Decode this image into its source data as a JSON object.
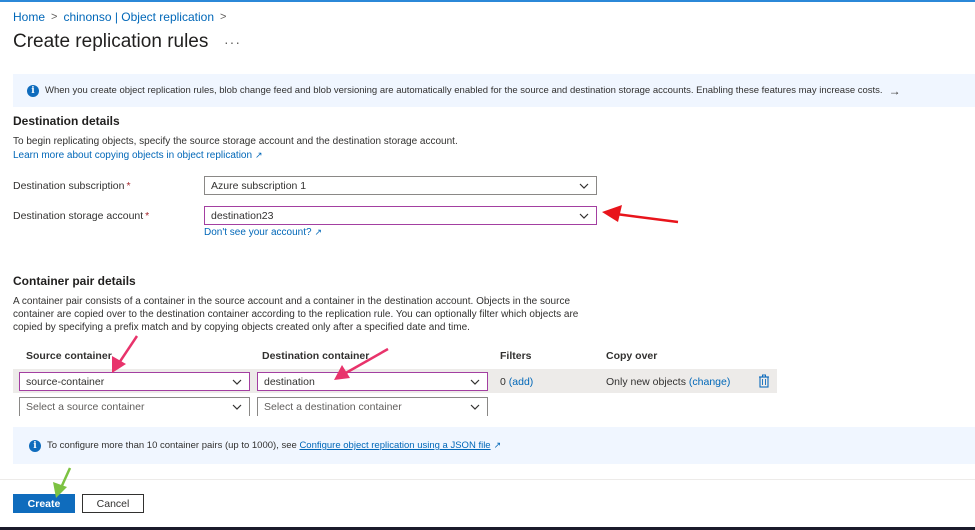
{
  "breadcrumb": {
    "home": "Home",
    "parent": "chinonso | Object replication"
  },
  "page": {
    "title": "Create replication rules",
    "more": "···"
  },
  "banner1": {
    "text": "When you create object replication rules, blob change feed and blob versioning are automatically enabled for the source and destination storage accounts. Enabling these features may increase costs.",
    "arrow": "→"
  },
  "destination": {
    "section_title": "Destination details",
    "description": "To begin replicating objects, specify the source storage account and the destination storage account.",
    "learn_more": "Learn more about copying objects in object replication",
    "subscription_label": "Destination subscription",
    "subscription_value": "Azure subscription 1",
    "account_label": "Destination storage account",
    "account_value": "destination23",
    "account_help": "Don't see your account?",
    "required_mark": "*"
  },
  "container_pairs": {
    "section_title": "Container pair details",
    "description_1": "A container pair consists of a container in the source account and a container in the destination account. Objects in the source",
    "description_2": "container are copied over to the destination container according to the replication rule. You can optionally filter which objects are",
    "description_3": "copied by specifying a prefix match and by copying objects created only after a specified date and time.",
    "headers": {
      "source": "Source container",
      "destination": "Destination container",
      "filters": "Filters",
      "copy_over": "Copy over"
    },
    "rows": [
      {
        "source": "source-container",
        "destination": "destination",
        "filters_count": "0",
        "filters_link": "(add)",
        "copy_over": "Only new objects",
        "copy_over_link": "(change)"
      }
    ],
    "new_row": {
      "source_placeholder": "Select a source container",
      "destination_placeholder": "Select a destination container"
    }
  },
  "banner2": {
    "text": "To configure more than 10 container pairs (up to 1000), see",
    "link": "Configure object replication using a JSON file"
  },
  "footer": {
    "create": "Create",
    "cancel": "Cancel"
  },
  "colors": {
    "accent": "#0f6cbd",
    "link": "#0067b8",
    "banner_bg": "#f0f6ff",
    "annotation_red": "#e8141b",
    "annotation_pink": "#e8336b",
    "annotation_green": "#7cc242"
  }
}
